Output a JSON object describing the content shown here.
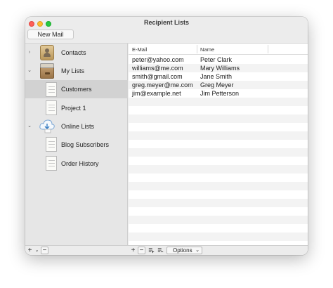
{
  "window": {
    "title": "Recipient Lists"
  },
  "toolbar": {
    "new_mail_label": "New Mail"
  },
  "sidebar": {
    "items": [
      {
        "label": "Contacts",
        "icon": "contacts-book-icon",
        "disclosure": "›"
      },
      {
        "label": "My Lists",
        "icon": "file-cabinet-icon",
        "disclosure": "⌄"
      },
      {
        "label": "Customers",
        "icon": "document-icon",
        "selected": true
      },
      {
        "label": "Project 1",
        "icon": "document-icon"
      },
      {
        "label": "Online Lists",
        "icon": "cloud-download-icon",
        "disclosure": "⌄"
      },
      {
        "label": "Blog Subscribers",
        "icon": "document-icon"
      },
      {
        "label": "Order History",
        "icon": "document-icon"
      }
    ]
  },
  "table": {
    "columns": [
      "E-Mail",
      "Name"
    ],
    "rows": [
      [
        "peter@yahoo.com",
        "Peter Clark"
      ],
      [
        "williams@me.com",
        "Mary Williams"
      ],
      [
        "smith@gmail.com",
        "Jane Smith"
      ],
      [
        "greg.meyer@me.com",
        "Greg Meyer"
      ],
      [
        "jim@example.net",
        "Jim Petterson"
      ]
    ]
  },
  "footer": {
    "sidebar_add": "+",
    "sidebar_add_chevron": "⌄",
    "sidebar_remove": "−",
    "table_add": "+",
    "table_remove": "−",
    "options_label": "Options",
    "options_chevron": "⌄"
  },
  "colors": {
    "close": "#fe5f57",
    "minimize": "#febc2e",
    "maximize": "#28c840",
    "selection": "#d2d2d2"
  }
}
